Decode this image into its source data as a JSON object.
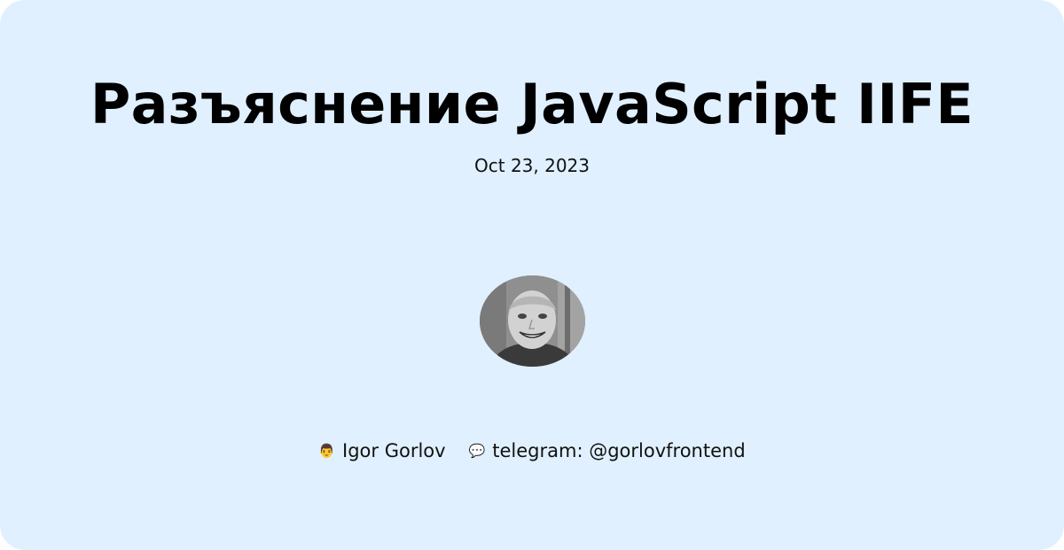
{
  "card": {
    "title": "Разъяснение JavaScript IIFE",
    "date": "Oct 23, 2023",
    "avatar_alt": "author photo"
  },
  "footer": {
    "author": {
      "icon": "person-icon",
      "glyph": "👨",
      "label": "Igor Gorlov"
    },
    "contact": {
      "icon": "speech-bubble-icon",
      "glyph": "💬",
      "label": "telegram: @gorlovfrontend"
    }
  },
  "colors": {
    "background": "#e0f0fe",
    "text": "#000000"
  }
}
